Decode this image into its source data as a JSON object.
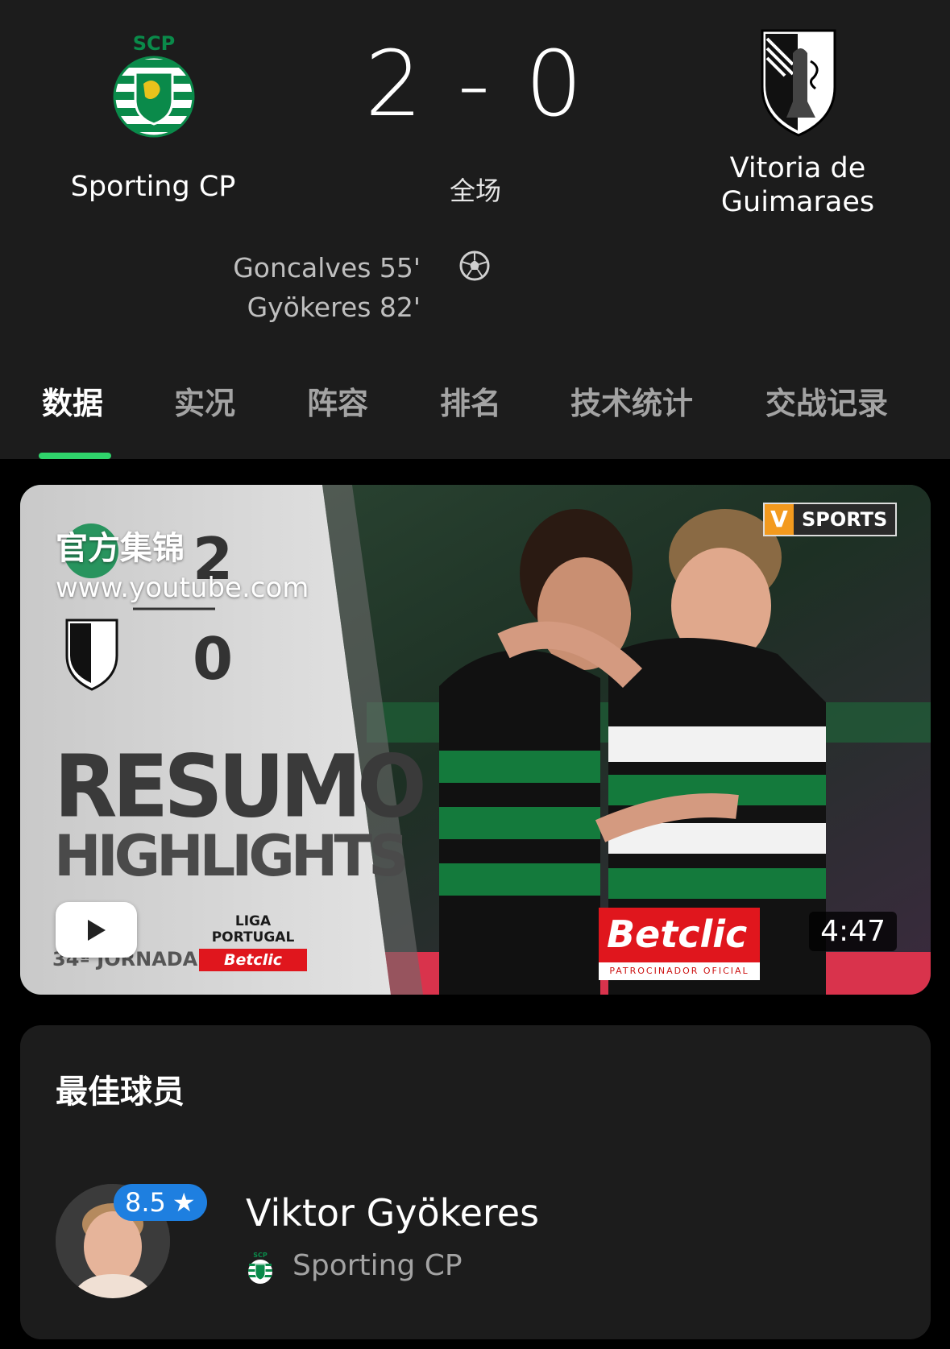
{
  "match": {
    "home_team": "Sporting CP",
    "away_team": "Vitoria de Guimaraes",
    "score": "2 - 0",
    "status": "全场",
    "goals": [
      "Goncalves 55'",
      "Gyökeres 82'"
    ]
  },
  "tabs": [
    {
      "label": "数据",
      "active": true
    },
    {
      "label": "实况",
      "active": false
    },
    {
      "label": "阵容",
      "active": false
    },
    {
      "label": "排名",
      "active": false
    },
    {
      "label": "技术统计",
      "active": false
    },
    {
      "label": "交战记录",
      "active": false
    }
  ],
  "video": {
    "title": "官方集锦",
    "source": "www.youtube.com",
    "duration": "4:47",
    "thumbnail_text": {
      "home_score": "2",
      "away_score": "0",
      "headline": "RESUMO",
      "subheadline": "HIGHLIGHTS",
      "channel_badge": "SPORTS",
      "channel_mark": "V",
      "league_top": "LIGA PORTUGAL",
      "league_bottom": "Betclic",
      "jornada": "34ª JORNADA",
      "sponsor": "Betclic",
      "sponsor_sub": "PATROCINADOR OFICIAL"
    }
  },
  "best_player": {
    "section_title": "最佳球员",
    "name": "Viktor Gyökeres",
    "team": "Sporting CP",
    "rating": "8.5"
  },
  "colors": {
    "background": "#1c1c1c",
    "accent_green": "#2fd46b",
    "rating_blue": "#1e7fe0",
    "sporting_green": "#00804a"
  }
}
